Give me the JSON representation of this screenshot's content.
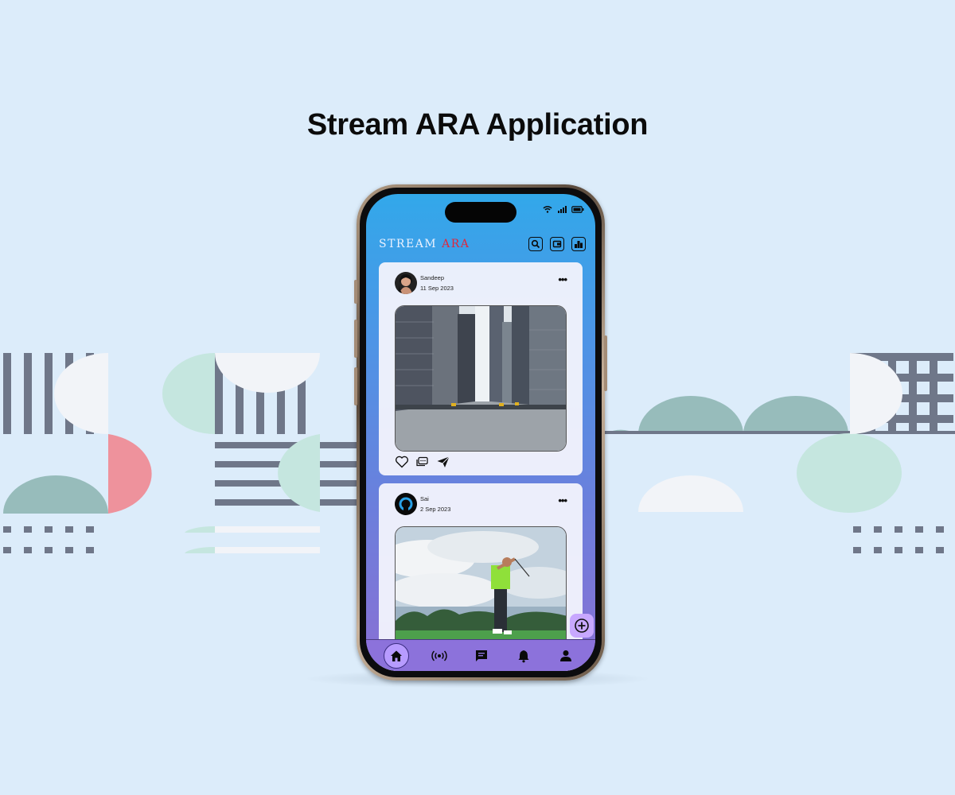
{
  "page": {
    "title": "Stream ARA Application"
  },
  "app": {
    "logo_main": "STREAM",
    "logo_accent": "ARA",
    "header_icons": [
      "search-icon",
      "wallet-icon",
      "leaderboard-icon"
    ],
    "status_icons": [
      "wifi-icon",
      "signal-icon",
      "battery-icon"
    ]
  },
  "posts": [
    {
      "user": "Sandeep",
      "date": "11 Sep 2023",
      "image": "city-street-photo",
      "actions": [
        "heart-icon",
        "comment-icon",
        "share-icon"
      ]
    },
    {
      "user": "Sai",
      "date": "2 Sep 2023",
      "image": "golfer-photo"
    }
  ],
  "nav": {
    "items": [
      "home-icon",
      "live-broadcast-icon",
      "chat-icon",
      "bell-icon",
      "profile-icon"
    ],
    "active": "home-icon"
  },
  "colors": {
    "background": "#dcecfa",
    "accent": "#e0263c",
    "screen_top": "#32a8ea",
    "screen_bottom": "#8a70d4",
    "nav": "#8c72db",
    "fab": "#c8a8ff"
  }
}
